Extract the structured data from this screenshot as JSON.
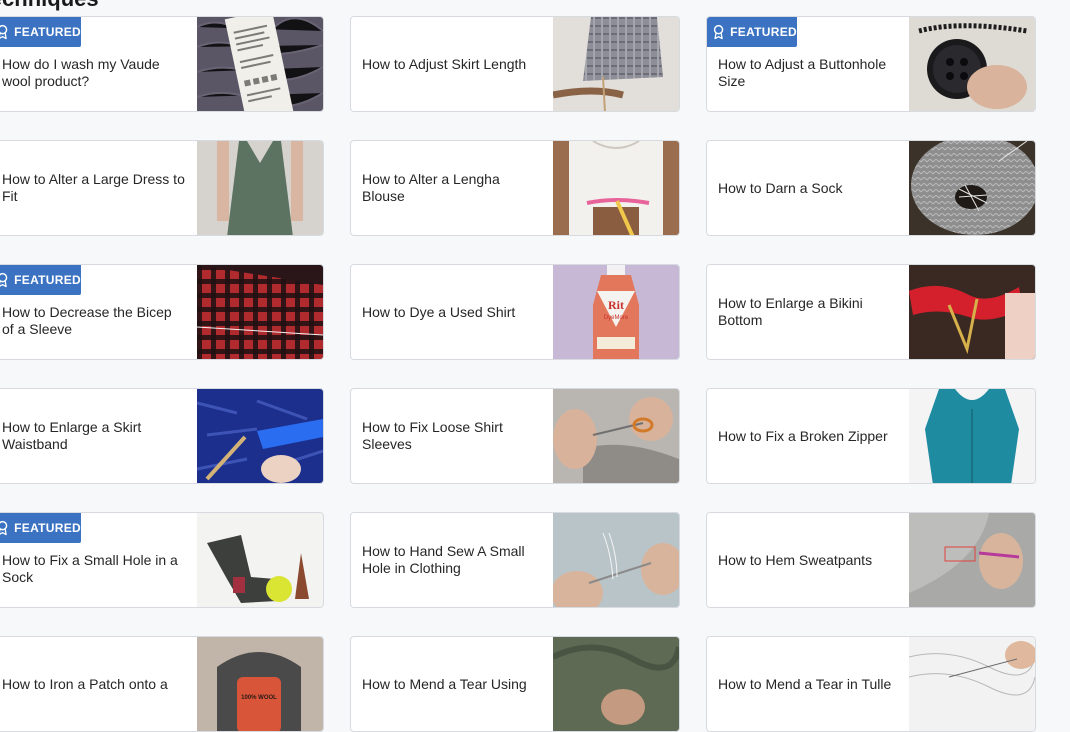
{
  "section": {
    "title": "Techniques"
  },
  "badge_label": "FEATURED",
  "cards": [
    {
      "title": "How do I wash my Vaude wool product?",
      "featured": true,
      "image": "wool-care-label"
    },
    {
      "title": "How to Adjust Skirt Length",
      "featured": false,
      "image": "plaid-skirt"
    },
    {
      "title": "How to Adjust a Buttonhole Size",
      "featured": true,
      "image": "black-button"
    },
    {
      "title": "How to Alter a Large Dress to Fit",
      "featured": false,
      "image": "green-dress"
    },
    {
      "title": "How to Alter a Lengha Blouse",
      "featured": false,
      "image": "measuring-blouse"
    },
    {
      "title": "How to Darn a Sock",
      "featured": false,
      "image": "gray-sock-darning"
    },
    {
      "title": "How to Decrease the Bicep of a Sleeve",
      "featured": true,
      "image": "plaid-sleeve"
    },
    {
      "title": "How to Dye a Used Shirt",
      "featured": false,
      "image": "rit-dye-bottle"
    },
    {
      "title": "How to Enlarge a Bikini Bottom",
      "featured": false,
      "image": "red-bikini"
    },
    {
      "title": "How to Enlarge a Skirt Waistband",
      "featured": false,
      "image": "blue-fabric-waistband"
    },
    {
      "title": "How to Fix Loose Shirt Sleeves",
      "featured": false,
      "image": "seam-ripper-sleeve"
    },
    {
      "title": "How to Fix a Broken Zipper",
      "featured": false,
      "image": "teal-dress"
    },
    {
      "title": "How to Fix a Small Hole in a Sock",
      "featured": true,
      "image": "sock-and-thread"
    },
    {
      "title": "How to Hand Sew A Small Hole in Clothing",
      "featured": false,
      "image": "needle-and-thread"
    },
    {
      "title": "How to Hem Sweatpants",
      "featured": false,
      "image": "gray-sweatpants"
    },
    {
      "title": "How to Iron a Patch onto a",
      "featured": false,
      "image": "iron-on-patch"
    },
    {
      "title": "How to Mend a Tear Using",
      "featured": false,
      "image": "olive-fabric-tear"
    },
    {
      "title": "How to Mend a Tear in Tulle",
      "featured": false,
      "image": "tulle-mending"
    }
  ],
  "thumb_text": {
    "rit": "Rit",
    "dyemore": "DyeMore",
    "label": "100% WOOL"
  }
}
